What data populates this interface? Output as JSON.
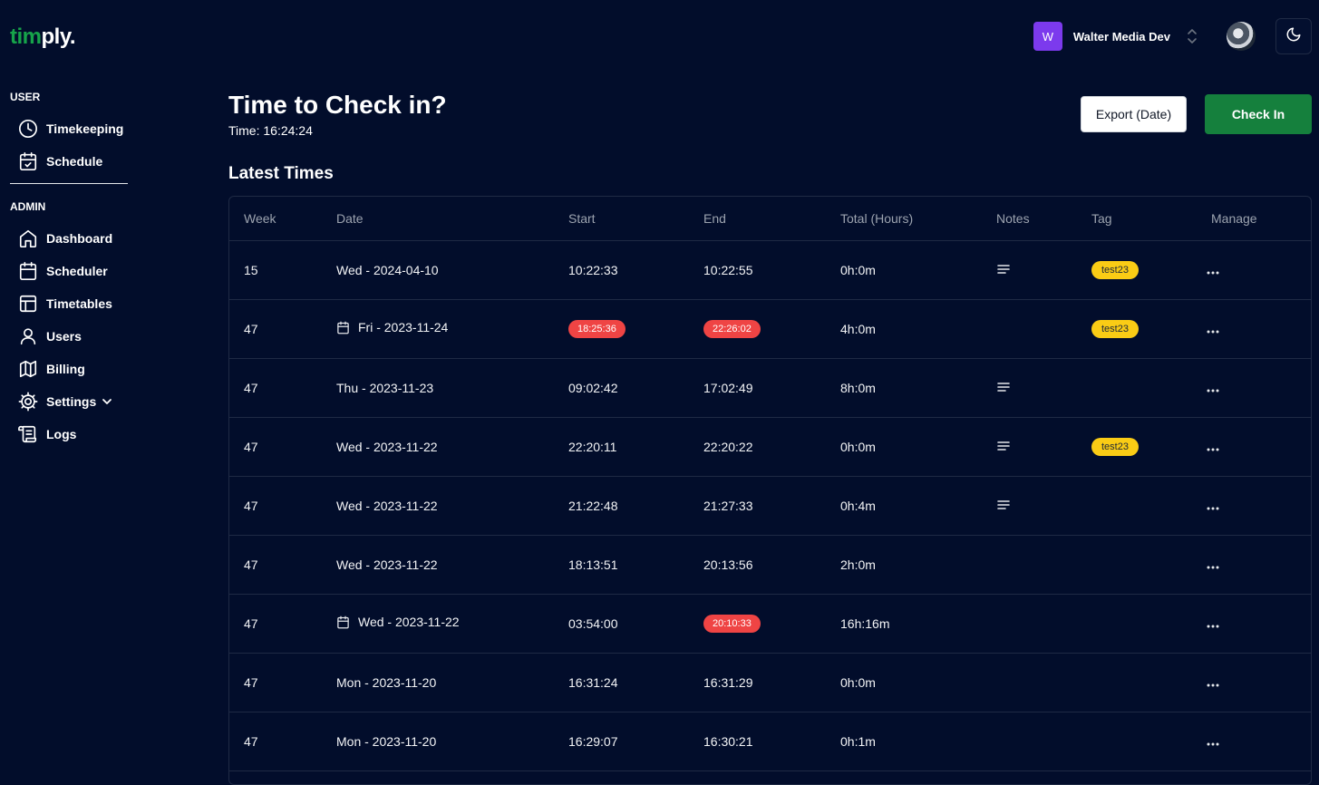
{
  "brand": {
    "part1": "tim",
    "part2": "ply."
  },
  "org": {
    "initial": "W",
    "name": "Walter Media Dev"
  },
  "sidebar": {
    "user_section": "USER",
    "user_items": [
      {
        "label": "Timekeeping",
        "icon": "clock-icon"
      },
      {
        "label": "Schedule",
        "icon": "calendar-check-icon"
      }
    ],
    "admin_section": "ADMIN",
    "admin_items": [
      {
        "label": "Dashboard",
        "icon": "home-icon"
      },
      {
        "label": "Scheduler",
        "icon": "calendar-icon"
      },
      {
        "label": "Timetables",
        "icon": "table-icon"
      },
      {
        "label": "Users",
        "icon": "user-icon"
      },
      {
        "label": "Billing",
        "icon": "map-icon"
      },
      {
        "label": "Settings",
        "icon": "gear-icon"
      },
      {
        "label": "Logs",
        "icon": "scroll-icon"
      }
    ]
  },
  "header": {
    "title": "Time to Check in?",
    "time": "Time: 16:24:24",
    "export_label": "Export (Date)",
    "checkin_label": "Check In",
    "section_title": "Latest Times"
  },
  "table": {
    "columns": [
      "Week",
      "Date",
      "Start",
      "End",
      "Total (Hours)",
      "Notes",
      "Tag",
      "Manage"
    ],
    "rows": [
      {
        "week": "15",
        "date": "Wed - 2024-04-10",
        "start": "10:22:33",
        "end": "10:22:55",
        "total": "0h:0m",
        "tag": "test23"
      },
      {
        "week": "47",
        "date": "Fri - 2023-11-24",
        "start": "18:25:36",
        "end": "22:26:02",
        "total": "4h:0m",
        "tag": "test23"
      },
      {
        "week": "47",
        "date": "Thu - 2023-11-23",
        "start": "09:02:42",
        "end": "17:02:49",
        "total": "8h:0m",
        "tag": ""
      },
      {
        "week": "47",
        "date": "Wed - 2023-11-22",
        "start": "22:20:11",
        "end": "22:20:22",
        "total": "0h:0m",
        "tag": "test23"
      },
      {
        "week": "47",
        "date": "Wed - 2023-11-22",
        "start": "21:22:48",
        "end": "21:27:33",
        "total": "0h:4m",
        "tag": ""
      },
      {
        "week": "47",
        "date": "Wed - 2023-11-22",
        "start": "18:13:51",
        "end": "20:13:56",
        "total": "2h:0m",
        "tag": ""
      },
      {
        "week": "47",
        "date": "Wed - 2023-11-22",
        "start": "03:54:00",
        "end": "20:10:33",
        "total": "16h:16m",
        "tag": ""
      },
      {
        "week": "47",
        "date": "Mon - 2023-11-20",
        "start": "16:31:24",
        "end": "16:31:29",
        "total": "0h:0m",
        "tag": ""
      },
      {
        "week": "47",
        "date": "Mon - 2023-11-20",
        "start": "16:29:07",
        "end": "16:30:21",
        "total": "0h:1m",
        "tag": ""
      }
    ]
  },
  "colors": {
    "background": "#020d2b",
    "brand_green": "#16a34a",
    "check_in": "#15803d",
    "warning_badge": "#ef4444",
    "tag_badge": "#facc15",
    "org_avatar": "#7c3aed"
  }
}
